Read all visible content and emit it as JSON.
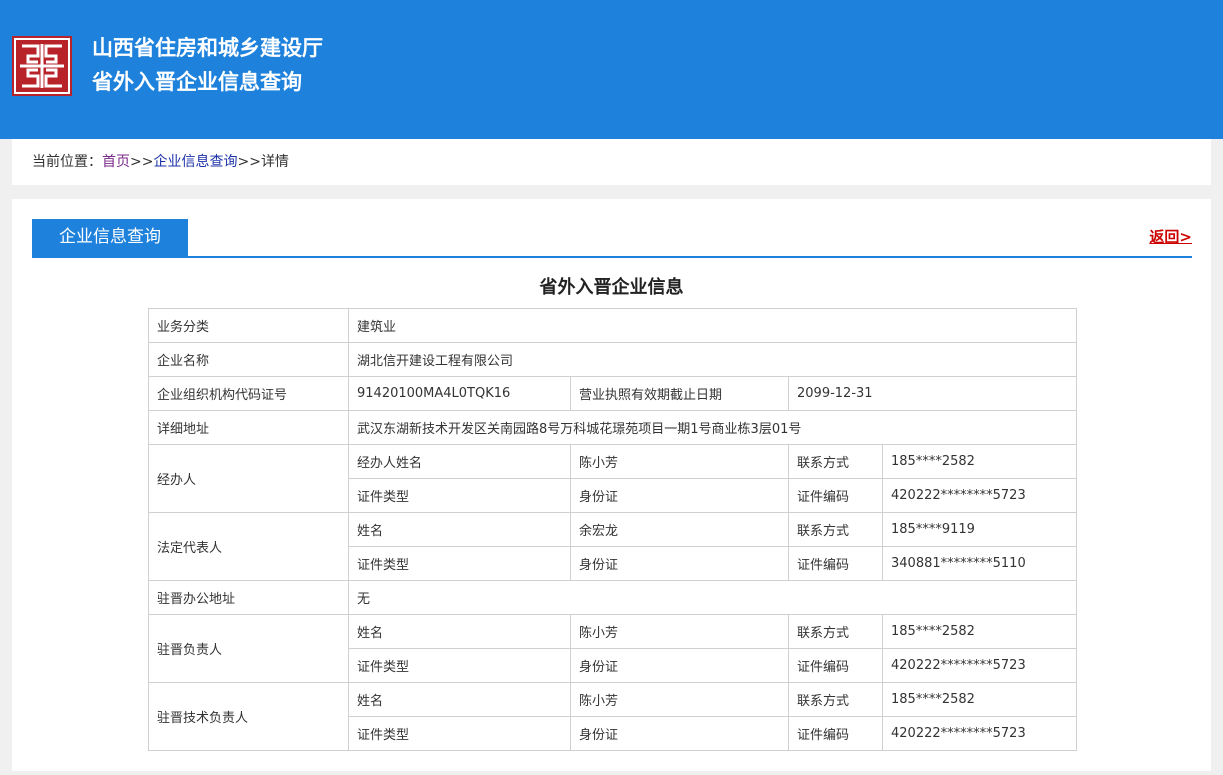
{
  "header": {
    "title_line1": "山西省住房和城乡建设厅",
    "title_line2": "省外入晋企业信息查询",
    "logo_icon": "chinese-pattern-logo-icon",
    "bg_color": "#1e82dc"
  },
  "breadcrumb": {
    "prefix": "当前位置：",
    "home": "首页",
    "sep1": ">>",
    "query": "企业信息查询",
    "sep2": ">>",
    "current": "详情"
  },
  "panel": {
    "tab_label": "企业信息查询",
    "back_label": "返回>",
    "page_title": "省外入晋企业信息"
  },
  "table": {
    "business_type_label": "业务分类",
    "business_type_value": "建筑业",
    "company_name_label": "企业名称",
    "company_name_value": "湖北信开建设工程有限公司",
    "org_code_label": "企业组织机构代码证号",
    "org_code_value": "91420100MA4L0TQK16",
    "license_expiry_label": "营业执照有效期截止日期",
    "license_expiry_value": "2099-12-31",
    "address_label": "详细地址",
    "address_value": "武汉东湖新技术开发区关南园路8号万科城花璟苑项目一期1号商业栋3层01号",
    "agent": {
      "group": "经办人",
      "name_label": "经办人姓名",
      "name": "陈小芳",
      "contact_label": "联系方式",
      "contact": "185****2582",
      "id_type_label": "证件类型",
      "id_type": "身份证",
      "id_no_label": "证件编码",
      "id_no": "420222********5723"
    },
    "legal": {
      "group": "法定代表人",
      "name_label": "姓名",
      "name": "余宏龙",
      "contact_label": "联系方式",
      "contact": "185****9119",
      "id_type_label": "证件类型",
      "id_type": "身份证",
      "id_no_label": "证件编码",
      "id_no": "340881********5110"
    },
    "office_label": "驻晋办公地址",
    "office_value": "无",
    "local_head": {
      "group": "驻晋负责人",
      "name_label": "姓名",
      "name": "陈小芳",
      "contact_label": "联系方式",
      "contact": "185****2582",
      "id_type_label": "证件类型",
      "id_type": "身份证",
      "id_no_label": "证件编码",
      "id_no": "420222********5723"
    },
    "tech_head": {
      "group": "驻晋技术负责人",
      "name_label": "姓名",
      "name": "陈小芳",
      "contact_label": "联系方式",
      "contact": "185****2582",
      "id_type_label": "证件类型",
      "id_type": "身份证",
      "id_no_label": "证件编码",
      "id_no": "420222********5723"
    }
  }
}
